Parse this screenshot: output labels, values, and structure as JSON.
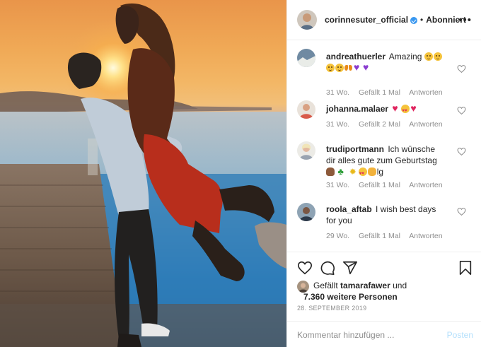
{
  "header": {
    "username": "corinnesuter_official",
    "separator": "•",
    "follow_state": "Abonniert",
    "more_icon": "more-horizontal-icon",
    "verified_icon": "verified-badge-icon"
  },
  "comments": [
    {
      "username": "andreathuerler",
      "text": "Amazing",
      "emojis": [
        "face",
        "face",
        "face",
        "face",
        "butterfly",
        "heart-purple",
        "heart-purple"
      ],
      "age": "31 Wo.",
      "likes": "Gefällt 1 Mal",
      "reply": "Antworten"
    },
    {
      "username": "johanna.malaer",
      "text": "",
      "emojis": [
        "heart-red",
        "eyes-heart",
        "heart-red"
      ],
      "age": "31 Wo.",
      "likes": "Gefällt 2 Mal",
      "reply": "Antworten"
    },
    {
      "username": "trudiportmann",
      "text": "Ich wünsche dir alles gute zum Geburtstag",
      "emojis": [
        "cake",
        "clover",
        "sparkle",
        "eyes-heart",
        "clap"
      ],
      "text_end": "lg",
      "age": "31 Wo.",
      "likes": "Gefällt 1 Mal",
      "reply": "Antworten"
    },
    {
      "username": "roola_aftab",
      "text": "I wish best days for you",
      "emojis": [],
      "age": "29 Wo.",
      "likes": "Gefällt 1 Mal",
      "reply": "Antworten"
    }
  ],
  "actions": {
    "like_icon": "heart-icon",
    "comment_icon": "comment-icon",
    "share_icon": "share-icon",
    "save_icon": "bookmark-icon"
  },
  "likes": {
    "prefix": "Gefällt",
    "user": "tamarafawer",
    "conj": "und",
    "others": "7.360 weitere Personen"
  },
  "date": "28. September 2019",
  "add_comment": {
    "placeholder": "Kommentar hinzufügen ...",
    "post_label": "Posten"
  },
  "colors": {
    "accent": "#3897f0",
    "post_button_disabled": "#b2dffc",
    "muted_text": "#8e8e8e",
    "border": "#efefef"
  }
}
